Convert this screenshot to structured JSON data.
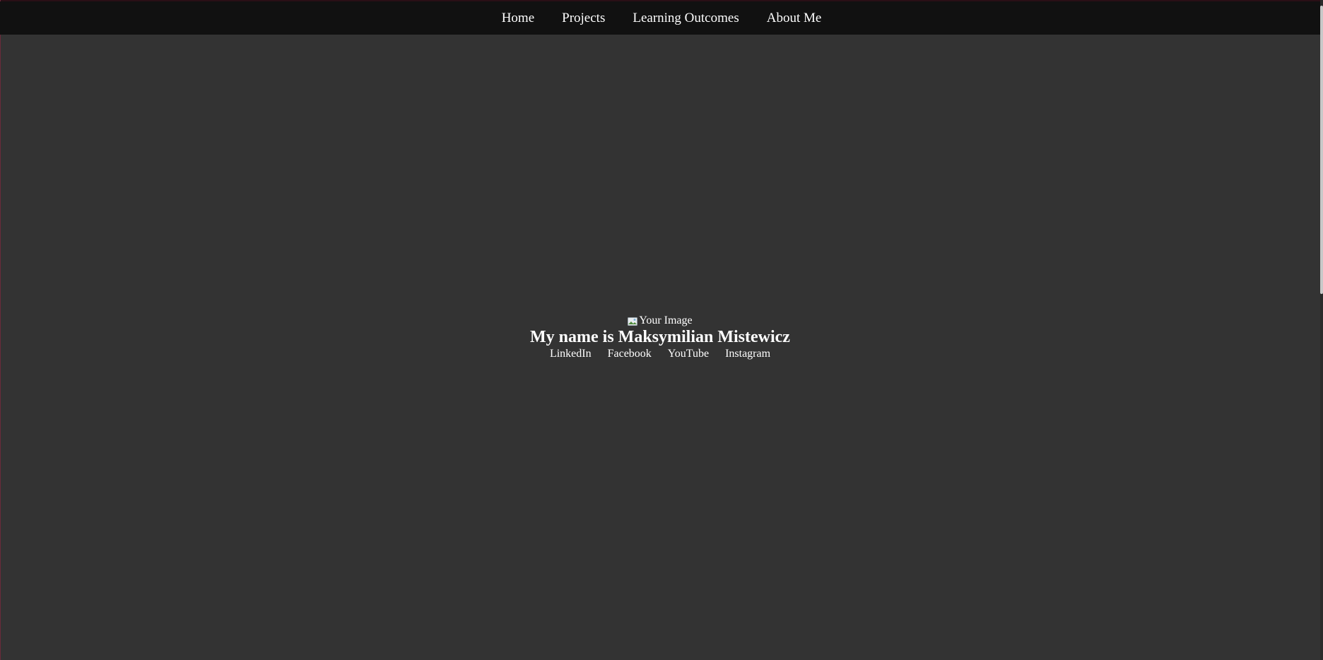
{
  "nav": {
    "items": [
      {
        "label": "Home"
      },
      {
        "label": "Projects"
      },
      {
        "label": "Learning Outcomes"
      },
      {
        "label": "About Me"
      }
    ]
  },
  "hero": {
    "image_alt": "Your Image",
    "image_icon": "broken-image-icon",
    "name": "My name is Maksymilian Mistewicz",
    "social": [
      {
        "label": "LinkedIn"
      },
      {
        "label": "Facebook"
      },
      {
        "label": "YouTube"
      },
      {
        "label": "Instagram"
      }
    ]
  },
  "colors": {
    "background": "#333333",
    "navbar": "#111111",
    "text": "#ffffff"
  }
}
